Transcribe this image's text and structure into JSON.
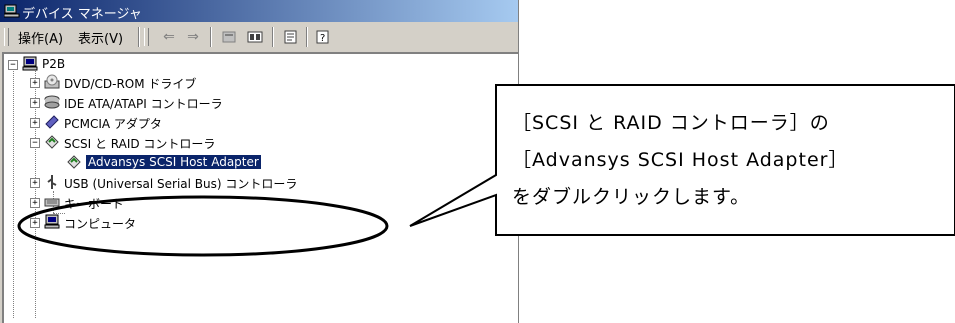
{
  "window": {
    "title": "デバイス マネージャ",
    "menu": [
      "操作(A)",
      "表示(V)"
    ],
    "toolbar_icons": [
      "back-arrow-icon",
      "forward-arrow-icon",
      "up-folder-icon",
      "view-icon",
      "properties-icon",
      "help-icon"
    ]
  },
  "tree": {
    "root": "P2B",
    "items": [
      {
        "label": "DVD/CD-ROM ドライブ",
        "icon": "cdrom-icon"
      },
      {
        "label": "IDE ATA/ATAPI コントローラ",
        "icon": "ide-controller-icon"
      },
      {
        "label": "PCMCIA アダプタ",
        "icon": "pcmcia-icon"
      },
      {
        "label": "SCSI と RAID コントローラ",
        "icon": "scsi-icon"
      },
      {
        "label": "Advansys SCSI Host Adapter",
        "icon": "scsi-device-icon",
        "selected": true
      },
      {
        "label": "USB (Universal Serial Bus) コントローラ",
        "icon": "usb-icon"
      },
      {
        "label": "キーボード",
        "icon": "keyboard-icon"
      },
      {
        "label": "コンピュータ",
        "icon": "computer-icon"
      }
    ]
  },
  "callout": {
    "line1": "［SCSI と RAID コントローラ］の",
    "line2": "［Advansys SCSI Host Adapter］",
    "line3": "をダブルクリックします。"
  },
  "colors": {
    "title_start": "#0a246a",
    "title_end": "#a6caf0",
    "selection": "#0a246a",
    "chrome": "#d4d0c8"
  }
}
